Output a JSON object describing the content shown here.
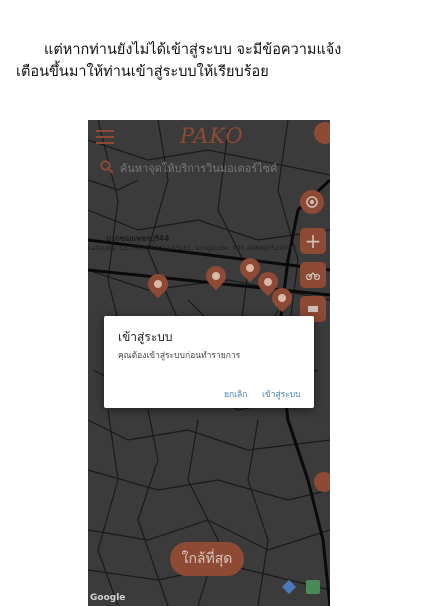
{
  "caption": {
    "line1": "แต่หากท่านยังไม่ได้เข้าสู่ระบบ จะมีข้อความแจ้ง",
    "line2": "เตือนขึ้นมาให้ท่านเข้าสู่ระบบให้เรียบร้อย"
  },
  "app": {
    "logo_text": "PAKO",
    "search_placeholder": "ค้นหาจุดให้บริการวินมอเตอร์ไซค์",
    "place_name": "ปากซอยเพชรบุรี44",
    "place_coords": "Latitude: 13.750058931193161, Longitude: 100.488893520087",
    "fab_plus": "+",
    "fab_minus": "−",
    "nearest_button": "ใกล้ที่สุด",
    "google_logo": "Google",
    "accent_color": "#8e4a34"
  },
  "dialog": {
    "title": "เข้าสู่ระบบ",
    "message": "คุณต้องเข้าสู่ระบบก่อนทำรายการ",
    "cancel": "ยกเลิก",
    "login": "เข้าสู่ระบบ"
  }
}
